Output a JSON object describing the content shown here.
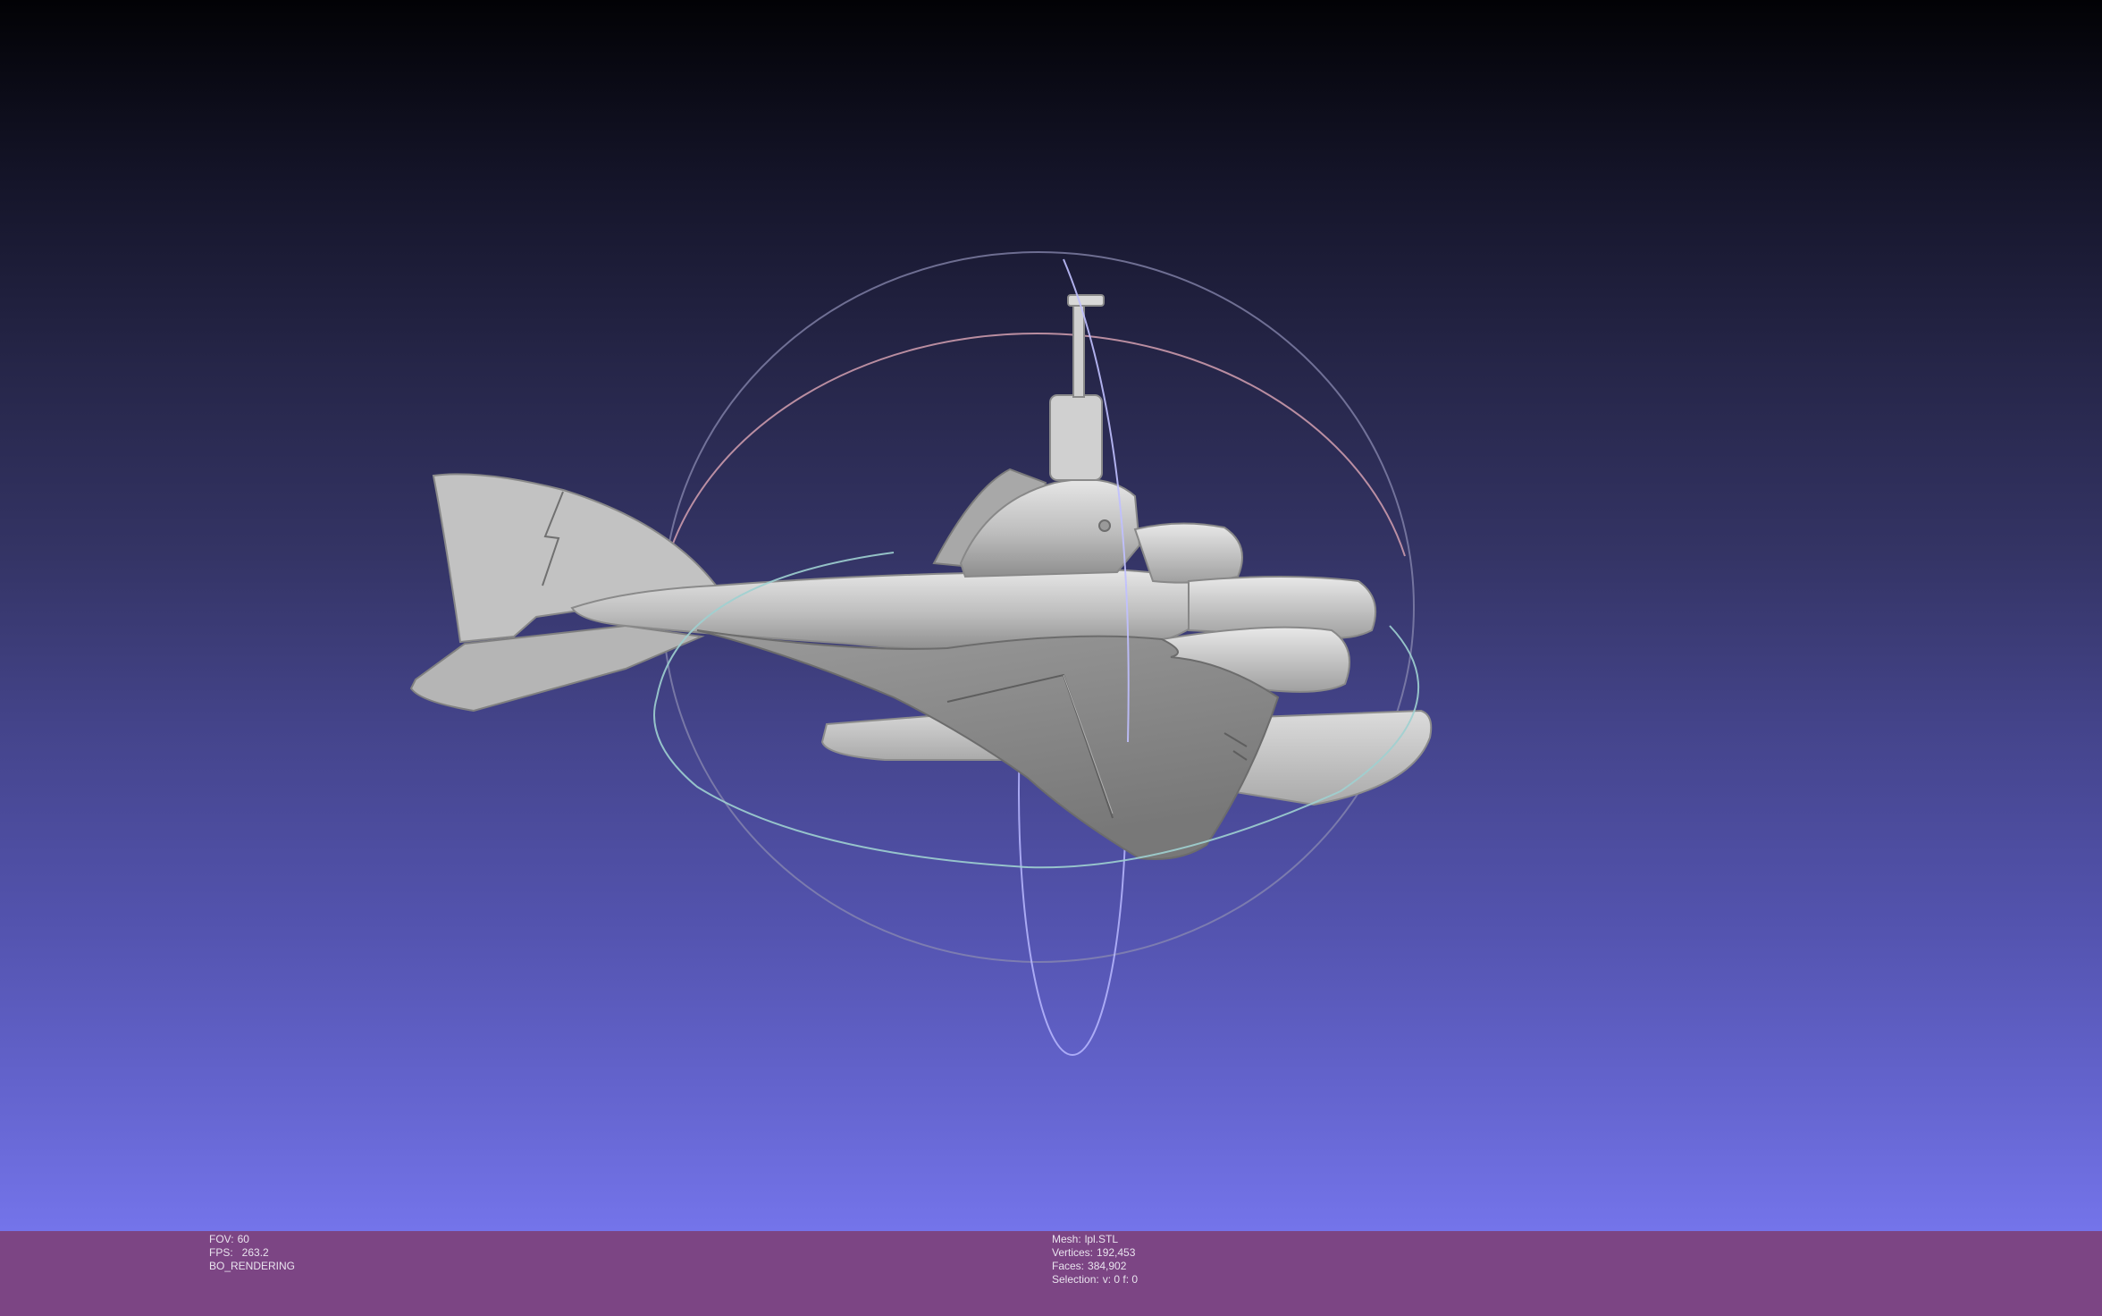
{
  "status_left": {
    "fov_label": "FOV:",
    "fov_value": "60",
    "fps_label": "FPS:",
    "fps_value": "263.2",
    "render_mode": "BO_RENDERING"
  },
  "status_right": {
    "mesh_label": "Mesh:",
    "mesh_value": "lpl.STL",
    "vertices_label": "Vertices:",
    "vertices_value": "192,453",
    "faces_label": "Faces:",
    "faces_value": "384,902",
    "selection_label": "Selection:",
    "selection_value": "v: 0 f: 0"
  },
  "colors": {
    "status_bar": "#7c4584",
    "background_top": "#020205",
    "background_bottom": "#7474ea",
    "mesh": "#c8c8c8",
    "trackball_horizontal": "#9fd0d0",
    "trackball_vertical": "#b8b8ff",
    "trackball_arc": "#d4a0b0"
  },
  "viewport": {
    "model": "seaplane-submarine-mesh",
    "gizmo": "trackball"
  }
}
